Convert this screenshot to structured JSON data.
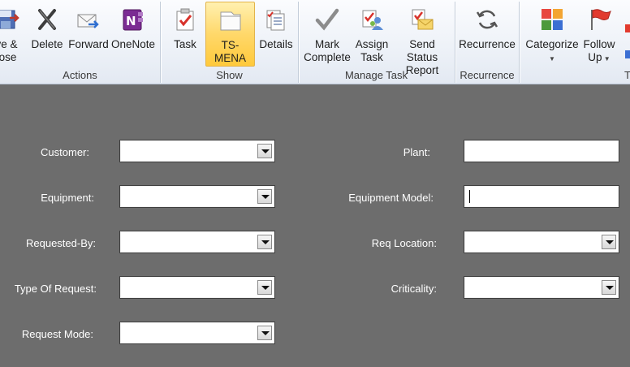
{
  "ribbon": {
    "groups": {
      "actions": "Actions",
      "show": "Show",
      "manage_task": "Manage Task",
      "recurrence": "Recurrence",
      "tags": "Tag"
    },
    "buttons": {
      "save_close": "ve &\nlose",
      "delete": "Delete",
      "forward": "Forward",
      "onenote": "OneNote",
      "task": "Task",
      "ts_mena": "TS-MENA",
      "details": "Details",
      "mark_complete": "Mark\nComplete",
      "assign_task": "Assign\nTask",
      "send_status_report": "Send Status\nReport",
      "recurrence": "Recurrence",
      "categorize": "Categorize",
      "follow_up": "Follow\nUp"
    },
    "icons": {
      "save_close": "save-close-icon",
      "delete": "delete-x-icon",
      "forward": "forward-envelope-icon",
      "onenote": "onenote-icon",
      "task": "task-clipboard-icon",
      "ts_mena": "custom-form-icon",
      "details": "details-icon",
      "mark_complete": "checkmark-icon",
      "assign_task": "assign-task-icon",
      "send_status_report": "status-report-envelope-icon",
      "recurrence": "recurrence-arrows-icon",
      "categorize": "color-category-icon",
      "follow_up": "flag-icon"
    },
    "colors": {
      "active_button": "#ffd86a"
    }
  },
  "form": {
    "customer": {
      "label": "Customer:",
      "value": ""
    },
    "equipment": {
      "label": "Equipment:",
      "value": ""
    },
    "requested_by": {
      "label": "Requested-By:",
      "value": ""
    },
    "type_of_request": {
      "label": "Type Of Request:",
      "value": ""
    },
    "request_mode": {
      "label": "Request Mode:",
      "value": ""
    },
    "plant": {
      "label": "Plant:",
      "value": ""
    },
    "equipment_model": {
      "label": "Equipment Model:",
      "value": ""
    },
    "req_location": {
      "label": "Req Location:",
      "value": ""
    },
    "criticality": {
      "label": "Criticality:",
      "value": ""
    }
  }
}
